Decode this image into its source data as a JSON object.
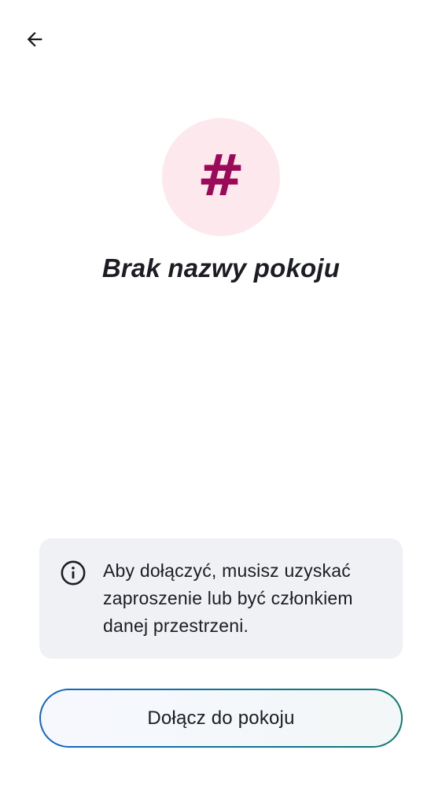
{
  "header": {
    "back_icon": "arrow-left-icon"
  },
  "room": {
    "avatar_symbol": "#",
    "avatar_icon": "hash-icon",
    "avatar_bg_color": "#fde8ee",
    "avatar_fg_color": "#9b0a58",
    "name": "Brak nazwy pokoju"
  },
  "info": {
    "icon": "info-icon",
    "message": "Aby dołączyć, musisz uzyskać zaproszenie lub być członkiem danej przestrzeni."
  },
  "actions": {
    "join_label": "Dołącz do pokoju"
  },
  "colors": {
    "text": "#1b1d22",
    "card_bg": "#eff1f5",
    "button_border_start": "#1366c7",
    "button_border_end": "#0e7b6e"
  }
}
